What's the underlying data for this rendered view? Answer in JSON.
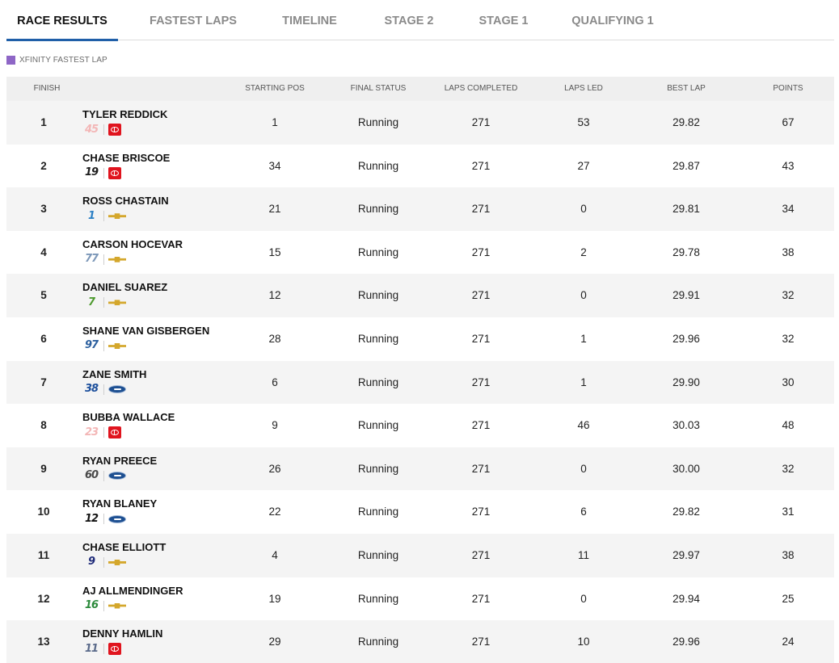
{
  "tabs": [
    {
      "label": "RACE RESULTS",
      "active": true
    },
    {
      "label": "FASTEST LAPS",
      "active": false
    },
    {
      "label": "TIMELINE",
      "active": false
    },
    {
      "label": "STAGE 2",
      "active": false
    },
    {
      "label": "STAGE 1",
      "active": false
    },
    {
      "label": "QUALIFYING 1",
      "active": false
    }
  ],
  "legend": {
    "label": "XFINITY FASTEST LAP",
    "color": "#8e66c6"
  },
  "columns": [
    "FINISH",
    "STARTING POS",
    "FINAL STATUS",
    "LAPS COMPLETED",
    "LAPS LED",
    "BEST LAP",
    "POINTS"
  ],
  "make_icons": {
    "toyota": "toyota-logo-icon",
    "chevrolet": "chevrolet-bowtie-icon",
    "ford": "ford-oval-icon"
  },
  "rows": [
    {
      "finish": "1",
      "driver": "TYLER REDDICK",
      "car": "45",
      "car_color": "#f3b6b6",
      "make": "toyota",
      "start": "1",
      "status": "Running",
      "laps": "271",
      "led": "53",
      "best": "29.82",
      "points": "67"
    },
    {
      "finish": "2",
      "driver": "CHASE BRISCOE",
      "car": "19",
      "car_color": "#1c1c1c",
      "make": "toyota",
      "start": "34",
      "status": "Running",
      "laps": "271",
      "led": "27",
      "best": "29.87",
      "points": "43"
    },
    {
      "finish": "3",
      "driver": "ROSS CHASTAIN",
      "car": "1",
      "car_color": "#2a7fc4",
      "make": "chevrolet",
      "start": "21",
      "status": "Running",
      "laps": "271",
      "led": "0",
      "best": "29.81",
      "points": "34"
    },
    {
      "finish": "4",
      "driver": "CARSON HOCEVAR",
      "car": "77",
      "car_color": "#7c97b8",
      "make": "chevrolet",
      "start": "15",
      "status": "Running",
      "laps": "271",
      "led": "2",
      "best": "29.78",
      "points": "38"
    },
    {
      "finish": "5",
      "driver": "DANIEL SUAREZ",
      "car": "7",
      "car_color": "#4d9a2e",
      "make": "chevrolet",
      "start": "12",
      "status": "Running",
      "laps": "271",
      "led": "0",
      "best": "29.91",
      "points": "32"
    },
    {
      "finish": "6",
      "driver": "SHANE VAN GISBERGEN",
      "car": "97",
      "car_color": "#2b5f9e",
      "make": "chevrolet",
      "start": "28",
      "status": "Running",
      "laps": "271",
      "led": "1",
      "best": "29.96",
      "points": "32"
    },
    {
      "finish": "7",
      "driver": "ZANE SMITH",
      "car": "38",
      "car_color": "#1c4f9c",
      "make": "ford",
      "start": "6",
      "status": "Running",
      "laps": "271",
      "led": "1",
      "best": "29.90",
      "points": "30"
    },
    {
      "finish": "8",
      "driver": "BUBBA WALLACE",
      "car": "23",
      "car_color": "#f3b6b6",
      "make": "toyota",
      "start": "9",
      "status": "Running",
      "laps": "271",
      "led": "46",
      "best": "30.03",
      "points": "48"
    },
    {
      "finish": "9",
      "driver": "RYAN PREECE",
      "car": "60",
      "car_color": "#4a4a4a",
      "make": "ford",
      "start": "26",
      "status": "Running",
      "laps": "271",
      "led": "0",
      "best": "30.00",
      "points": "32"
    },
    {
      "finish": "10",
      "driver": "RYAN BLANEY",
      "car": "12",
      "car_color": "#111111",
      "make": "ford",
      "start": "22",
      "status": "Running",
      "laps": "271",
      "led": "6",
      "best": "29.82",
      "points": "31"
    },
    {
      "finish": "11",
      "driver": "CHASE ELLIOTT",
      "car": "9",
      "car_color": "#1e2a78",
      "make": "chevrolet",
      "start": "4",
      "status": "Running",
      "laps": "271",
      "led": "11",
      "best": "29.97",
      "points": "38"
    },
    {
      "finish": "12",
      "driver": "AJ ALLMENDINGER",
      "car": "16",
      "car_color": "#2c8a3c",
      "make": "chevrolet",
      "start": "19",
      "status": "Running",
      "laps": "271",
      "led": "0",
      "best": "29.94",
      "points": "25"
    },
    {
      "finish": "13",
      "driver": "DENNY HAMLIN",
      "car": "11",
      "car_color": "#5a6a8a",
      "make": "toyota",
      "start": "29",
      "status": "Running",
      "laps": "271",
      "led": "10",
      "best": "29.96",
      "points": "24"
    }
  ]
}
